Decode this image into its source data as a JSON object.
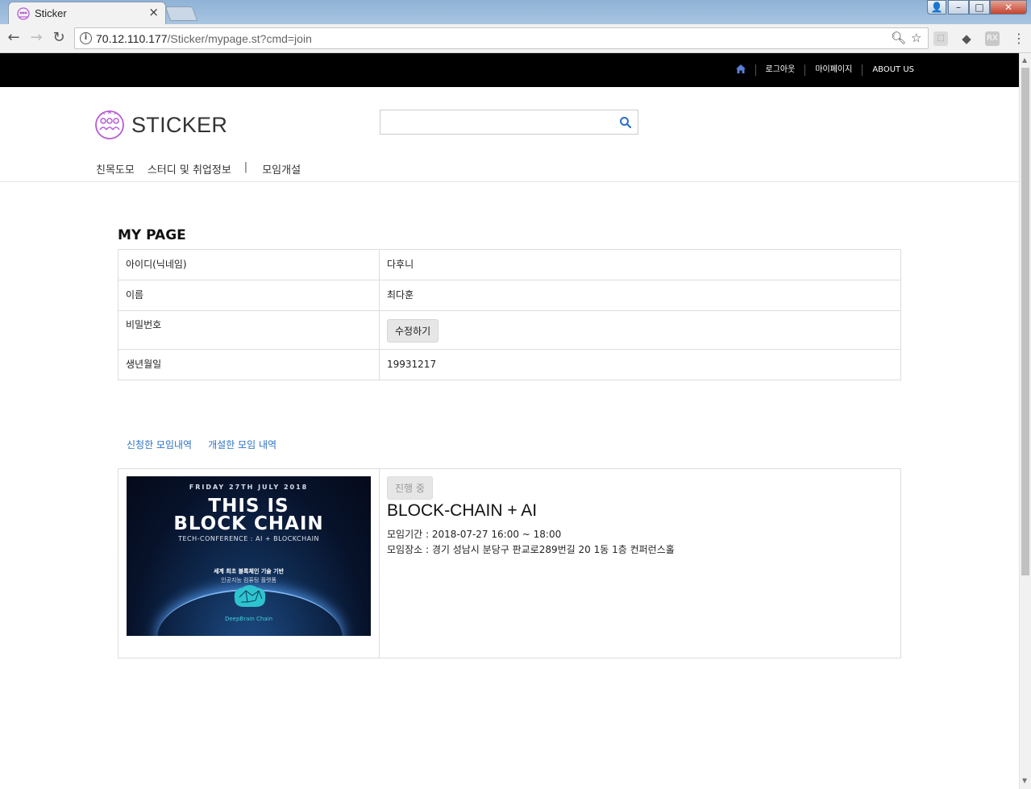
{
  "browser": {
    "tab_title": "Sticker",
    "close_symbol": "×",
    "url_host": "70.12.110.177",
    "url_path": "/Sticker/mypage.st?cmd=join"
  },
  "topnav": {
    "logout": "로그아웃",
    "mypage": "마이페이지",
    "about": "ABOUT US"
  },
  "brand": {
    "logo_text": "STICKER",
    "accent_color": "#b55bd6"
  },
  "search": {
    "placeholder": "",
    "value": ""
  },
  "mainnav": {
    "item1": "친목도모",
    "item2": "스터디 및 취업정보",
    "separator": "|",
    "item3": "모임개설"
  },
  "mypage": {
    "title": "MY PAGE",
    "rows": [
      {
        "label": "아이디(닉네임)",
        "value": "다후니"
      },
      {
        "label": "이름",
        "value": "최다훈"
      },
      {
        "label": "비밀번호",
        "button": "수정하기"
      },
      {
        "label": "생년월일",
        "value": "19931217"
      }
    ]
  },
  "tabs": {
    "applied": "신청한 모임내역",
    "created": "개설한 모임 내역"
  },
  "meeting": {
    "status": "진행 중",
    "title": "BLOCK-CHAIN + AI",
    "period": "모임기간 : 2018-07-27 16:00 ~ 18:00",
    "place": "모임장소 : 경기 성남시 분당구 판교로289번길 20 1동 1층 컨퍼런스홀",
    "poster": {
      "date": "FRIDAY 27TH JULY 2018",
      "headline_1": "THIS IS",
      "headline_2": "BLOCK CHAIN",
      "subtitle": "TECH-CONFERENCE : AI + BLOCKCHAIN",
      "ko_line1": "세계 최초 블록체인 기술 기반",
      "ko_line2": "인공지능 컴퓨팅 플랫폼",
      "brand": "DeepBrain Chain"
    }
  }
}
